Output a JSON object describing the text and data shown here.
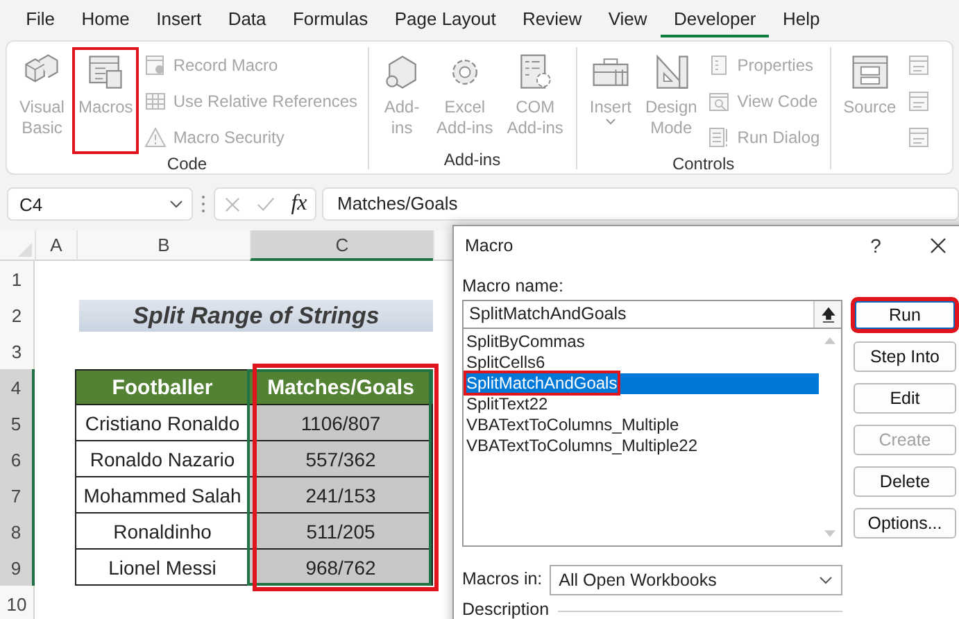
{
  "menu_tabs": [
    {
      "label": "File",
      "selected": false
    },
    {
      "label": "Home",
      "selected": false
    },
    {
      "label": "Insert",
      "selected": false
    },
    {
      "label": "Data",
      "selected": false
    },
    {
      "label": "Formulas",
      "selected": false
    },
    {
      "label": "Page Layout",
      "selected": false
    },
    {
      "label": "Review",
      "selected": false
    },
    {
      "label": "View",
      "selected": false
    },
    {
      "label": "Developer",
      "selected": true
    },
    {
      "label": "Help",
      "selected": false
    }
  ],
  "ribbon": {
    "groups": [
      {
        "name": "Code",
        "large": [
          {
            "label": "Visual\nBasic",
            "disabled": true,
            "highlighted": false
          },
          {
            "label": "Macros",
            "disabled": true,
            "highlighted": true
          }
        ],
        "small": [
          {
            "label": "Record Macro",
            "disabled": true
          },
          {
            "label": "Use Relative References",
            "disabled": true
          },
          {
            "label": "Macro Security",
            "disabled": true
          }
        ]
      },
      {
        "name": "Add-ins",
        "large": [
          {
            "label": "Add-\nins",
            "disabled": true,
            "highlighted": false
          },
          {
            "label": "Excel\nAdd-ins",
            "disabled": true,
            "highlighted": false
          },
          {
            "label": "COM\nAdd-ins",
            "disabled": true,
            "highlighted": false
          }
        ]
      },
      {
        "name": "Controls",
        "large": [
          {
            "label": "Insert",
            "disabled": true,
            "highlighted": false,
            "dropdown": true
          },
          {
            "label": "Design\nMode",
            "disabled": true,
            "highlighted": false
          }
        ],
        "small": [
          {
            "label": "Properties",
            "disabled": true
          },
          {
            "label": "View Code",
            "disabled": true
          },
          {
            "label": "Run Dialog",
            "disabled": true
          }
        ]
      },
      {
        "large": [
          {
            "label": "Source",
            "disabled": true,
            "highlighted": false
          }
        ],
        "small": [
          {
            "disabled": true
          },
          {
            "disabled": true
          },
          {
            "disabled": true
          }
        ]
      }
    ]
  },
  "formula_bar": {
    "name_box": "C4",
    "function_label": "fx",
    "formula": "Matches/Goals"
  },
  "sheet": {
    "column_headers": [
      {
        "label": "A",
        "selected": false
      },
      {
        "label": "B",
        "selected": false
      },
      {
        "label": "C",
        "selected": true
      }
    ],
    "row_headers": [
      {
        "label": "1",
        "selected": false
      },
      {
        "label": "2",
        "selected": false
      },
      {
        "label": "3",
        "selected": false
      },
      {
        "label": "4",
        "selected": true
      },
      {
        "label": "5",
        "selected": true
      },
      {
        "label": "6",
        "selected": true
      },
      {
        "label": "7",
        "selected": true
      },
      {
        "label": "8",
        "selected": true
      },
      {
        "label": "9",
        "selected": true
      },
      {
        "label": "10",
        "selected": false
      }
    ],
    "title": "Split Range of Strings",
    "table": {
      "columns": [
        {
          "label": "Footballer",
          "selected": false,
          "highlighted": false
        },
        {
          "label": "Matches/Goals",
          "selected": true,
          "highlighted": true
        }
      ],
      "rows": [
        [
          "Cristiano Ronaldo",
          "1106/807"
        ],
        [
          "Ronaldo Nazario",
          "557/362"
        ],
        [
          "Mohammed Salah",
          "241/153"
        ],
        [
          "Ronaldinho",
          "511/205"
        ],
        [
          "Lionel Messi",
          "968/762"
        ]
      ]
    }
  },
  "dialog": {
    "title": "Macro",
    "help": "?",
    "name_label": "Macro name:",
    "name_value": "SplitMatchAndGoals",
    "macros": [
      {
        "label": "SplitByCommas",
        "selected": false,
        "highlighted": false
      },
      {
        "label": "SplitCells6",
        "selected": false,
        "highlighted": false
      },
      {
        "label": "SplitMatchAndGoals",
        "selected": true,
        "highlighted": true
      },
      {
        "label": "SplitText22",
        "selected": false,
        "highlighted": false
      },
      {
        "label": "VBATextToColumns_Multiple",
        "selected": false,
        "highlighted": false
      },
      {
        "label": "VBATextToColumns_Multiple22",
        "selected": false,
        "highlighted": false
      }
    ],
    "buttons": [
      {
        "label": "Run",
        "default": true,
        "disabled": false,
        "highlighted": true
      },
      {
        "label": "Step Into",
        "default": false,
        "disabled": false,
        "highlighted": false
      },
      {
        "label": "Edit",
        "default": false,
        "disabled": false,
        "highlighted": false
      },
      {
        "label": "Create",
        "default": false,
        "disabled": true,
        "highlighted": false
      },
      {
        "label": "Delete",
        "default": false,
        "disabled": false,
        "highlighted": false
      },
      {
        "label": "Options...",
        "default": false,
        "disabled": false,
        "highlighted": false
      }
    ],
    "macros_in_label": "Macros in:",
    "macros_in_value": "All Open Workbooks",
    "description_label": "Description"
  }
}
